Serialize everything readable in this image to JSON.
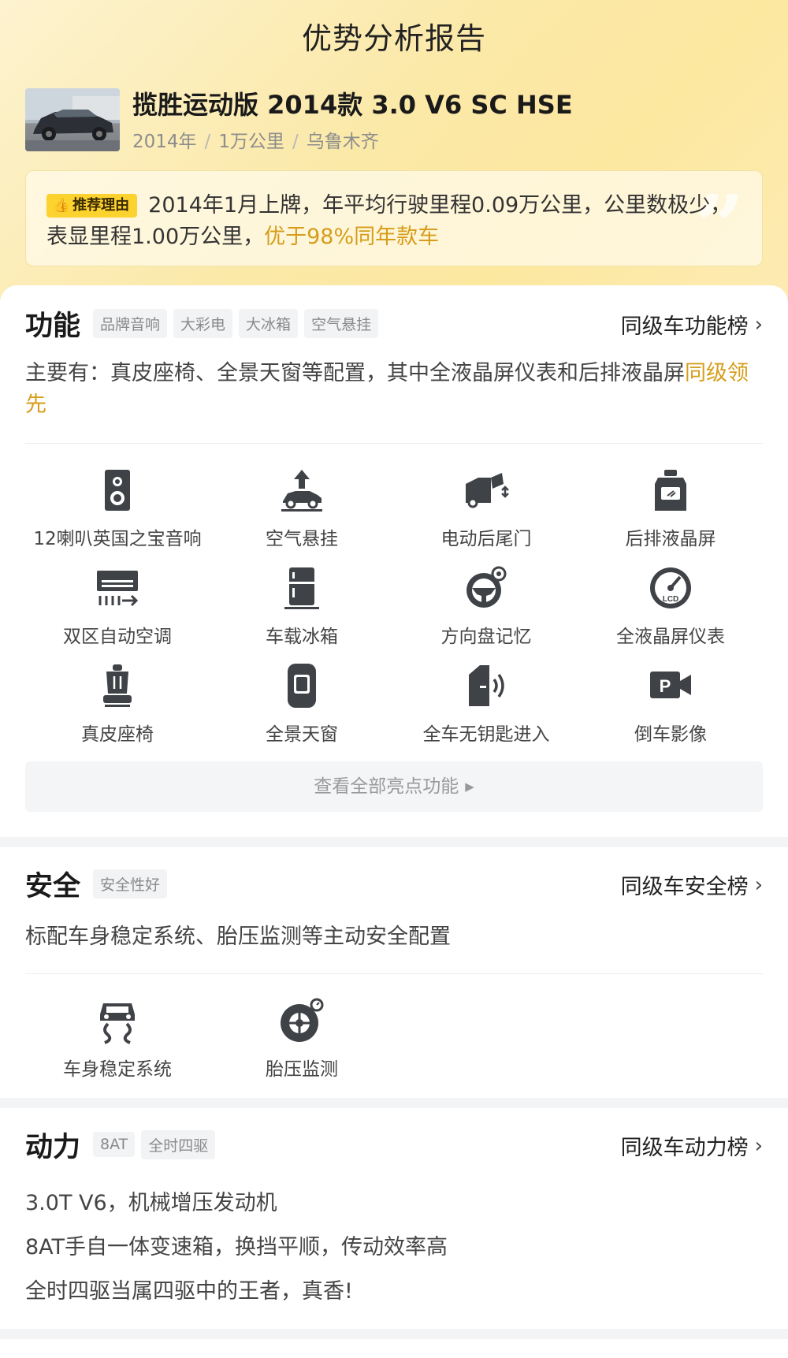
{
  "page_title": "优势分析报告",
  "car": {
    "name": "揽胜运动版 2014款 3.0 V6 SC HSE",
    "year": "2014年",
    "mileage": "1万公里",
    "city": "乌鲁木齐",
    "separator": "/"
  },
  "reason": {
    "badge": "推荐理由",
    "text": "2014年1月上牌，年平均行驶里程0.09万公里，公里数极少，表显里程1.00万公里，",
    "highlight": "优于98%同年款车"
  },
  "function": {
    "title": "功能",
    "tags": [
      "品牌音响",
      "大彩电",
      "大冰箱",
      "空气悬挂"
    ],
    "link": "同级车功能榜",
    "desc": "主要有：真皮座椅、全景天窗等配置，其中全液晶屏仪表和后排液晶屏",
    "desc_highlight": "同级领先",
    "features": [
      {
        "label": "12喇叭英国之宝音响",
        "icon": "speaker-icon"
      },
      {
        "label": "空气悬挂",
        "icon": "air-suspension-icon"
      },
      {
        "label": "电动后尾门",
        "icon": "power-tailgate-icon"
      },
      {
        "label": "后排液晶屏",
        "icon": "rear-screen-icon"
      },
      {
        "label": "双区自动空调",
        "icon": "air-conditioner-icon"
      },
      {
        "label": "车载冰箱",
        "icon": "fridge-icon"
      },
      {
        "label": "方向盘记忆",
        "icon": "steering-memory-icon"
      },
      {
        "label": "全液晶屏仪表",
        "icon": "lcd-gauge-icon"
      },
      {
        "label": "真皮座椅",
        "icon": "leather-seat-icon"
      },
      {
        "label": "全景天窗",
        "icon": "sunroof-icon"
      },
      {
        "label": "全车无钥匙进入",
        "icon": "keyless-entry-icon"
      },
      {
        "label": "倒车影像",
        "icon": "reverse-camera-icon"
      }
    ],
    "view_all": "查看全部亮点功能"
  },
  "safety": {
    "title": "安全",
    "tags": [
      "安全性好"
    ],
    "link": "同级车安全榜",
    "desc": "标配车身稳定系统、胎压监测等主动安全配置",
    "features": [
      {
        "label": "车身稳定系统",
        "icon": "stability-control-icon"
      },
      {
        "label": "胎压监测",
        "icon": "tire-pressure-icon"
      }
    ]
  },
  "power": {
    "title": "动力",
    "tags": [
      "8AT",
      "全时四驱"
    ],
    "link": "同级车动力榜",
    "lines": [
      "3.0T V6，机械增压发动机",
      "8AT手自一体变速箱，换挡平顺，传动效率高",
      "全时四驱当属四驱中的王者，真香!"
    ]
  },
  "colors": {
    "accent": "#d69d1a",
    "badge": "#fcd22f",
    "icon": "#3f4246"
  }
}
